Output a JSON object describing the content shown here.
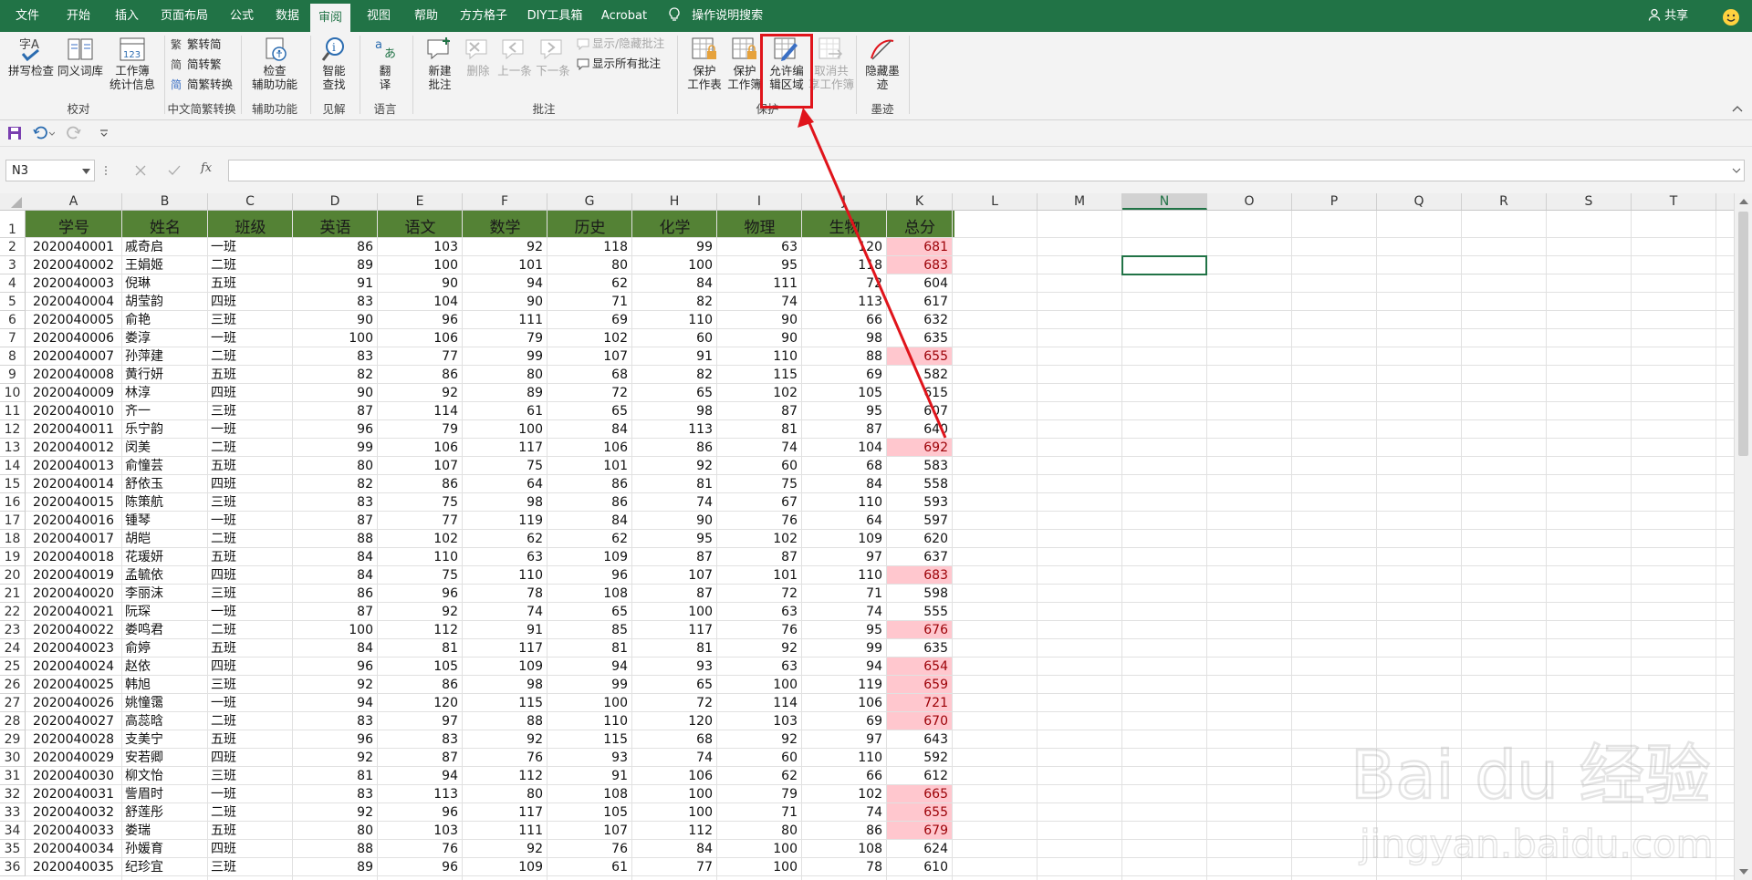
{
  "tabs": [
    {
      "label": "文件"
    },
    {
      "label": "开始"
    },
    {
      "label": "插入"
    },
    {
      "label": "页面布局"
    },
    {
      "label": "公式"
    },
    {
      "label": "数据"
    },
    {
      "label": "审阅"
    },
    {
      "label": "视图"
    },
    {
      "label": "帮助"
    },
    {
      "label": "方方格子"
    },
    {
      "label": "DIY工具箱"
    },
    {
      "label": "Acrobat"
    }
  ],
  "active_tab": "审阅",
  "search_label": "操作说明搜索",
  "share_label": "共享",
  "ribbon": {
    "spell": "拼写检查",
    "thesaurus": "同义词库",
    "stats_l1": "工作簿",
    "stats_l2": "统计信息",
    "g_proof": "校对",
    "t2s": "繁转简",
    "s2t": "简转繁",
    "conv": "简繁转换",
    "g_chinese": "中文简繁转换",
    "access_l1": "检查",
    "access_l2": "辅助功能",
    "g_access": "辅助功能",
    "smart_l1": "智能",
    "smart_l2": "查找",
    "g_insights": "见解",
    "translate_l1": "翻",
    "translate_l2": "译",
    "g_lang": "语言",
    "newc_l1": "新建",
    "newc_l2": "批注",
    "del": "删除",
    "prev": "上一条",
    "next": "下一条",
    "showhide": "显示/隐藏批注",
    "showall": "显示所有批注",
    "g_comments": "批注",
    "psheet_l1": "保护",
    "psheet_l2": "工作表",
    "pbook_l1": "保护",
    "pbook_l2": "工作簿",
    "allow_l1": "允许编",
    "allow_l2": "辑区域",
    "unshare_l1": "取消共",
    "unshare_l2": "享工作簿",
    "g_protect": "保护",
    "ink_l1": "隐藏墨",
    "ink_l2": "迹",
    "g_ink": "墨迹"
  },
  "name_box": "N3",
  "fx": "fx",
  "columns": [
    "A",
    "B",
    "C",
    "D",
    "E",
    "F",
    "G",
    "H",
    "I",
    "J",
    "K",
    "L",
    "M",
    "N",
    "O",
    "P",
    "Q",
    "R",
    "S",
    "T"
  ],
  "header_row": [
    "学号",
    "姓名",
    "班级",
    "英语",
    "语文",
    "数学",
    "历史",
    "化学",
    "物理",
    "生物",
    "总分"
  ],
  "rows": [
    [
      "2020040001",
      "戚奇启",
      "一班",
      "86",
      "103",
      "92",
      "118",
      "99",
      "63",
      "120",
      "681"
    ],
    [
      "2020040002",
      "王娟姬",
      "二班",
      "89",
      "100",
      "101",
      "80",
      "100",
      "95",
      "118",
      "683"
    ],
    [
      "2020040003",
      "倪琳",
      "五班",
      "91",
      "90",
      "94",
      "62",
      "84",
      "111",
      "72",
      "604"
    ],
    [
      "2020040004",
      "胡莹韵",
      "四班",
      "83",
      "104",
      "90",
      "71",
      "82",
      "74",
      "113",
      "617"
    ],
    [
      "2020040005",
      "俞艳",
      "三班",
      "90",
      "96",
      "111",
      "69",
      "110",
      "90",
      "66",
      "632"
    ],
    [
      "2020040006",
      "娄淳",
      "一班",
      "100",
      "106",
      "79",
      "102",
      "60",
      "90",
      "98",
      "635"
    ],
    [
      "2020040007",
      "孙萍建",
      "二班",
      "83",
      "77",
      "99",
      "107",
      "91",
      "110",
      "88",
      "655"
    ],
    [
      "2020040008",
      "黄行妍",
      "五班",
      "82",
      "86",
      "80",
      "68",
      "82",
      "115",
      "69",
      "582"
    ],
    [
      "2020040009",
      "林淳",
      "四班",
      "90",
      "92",
      "89",
      "72",
      "65",
      "102",
      "105",
      "615"
    ],
    [
      "2020040010",
      "齐一",
      "三班",
      "87",
      "114",
      "61",
      "65",
      "98",
      "87",
      "95",
      "607"
    ],
    [
      "2020040011",
      "乐宁韵",
      "一班",
      "96",
      "79",
      "100",
      "84",
      "113",
      "81",
      "87",
      "640"
    ],
    [
      "2020040012",
      "闵美",
      "二班",
      "99",
      "106",
      "117",
      "106",
      "86",
      "74",
      "104",
      "692"
    ],
    [
      "2020040013",
      "俞憧芸",
      "五班",
      "80",
      "107",
      "75",
      "101",
      "92",
      "60",
      "68",
      "583"
    ],
    [
      "2020040014",
      "舒依玉",
      "四班",
      "82",
      "86",
      "64",
      "86",
      "81",
      "75",
      "84",
      "558"
    ],
    [
      "2020040015",
      "陈策航",
      "三班",
      "83",
      "75",
      "98",
      "86",
      "74",
      "67",
      "110",
      "593"
    ],
    [
      "2020040016",
      "锺琴",
      "一班",
      "87",
      "77",
      "119",
      "84",
      "90",
      "76",
      "64",
      "597"
    ],
    [
      "2020040017",
      "胡皑",
      "二班",
      "88",
      "102",
      "62",
      "62",
      "95",
      "102",
      "109",
      "620"
    ],
    [
      "2020040018",
      "花瑗妍",
      "五班",
      "84",
      "110",
      "63",
      "109",
      "87",
      "87",
      "97",
      "637"
    ],
    [
      "2020040019",
      "孟毓依",
      "四班",
      "84",
      "75",
      "110",
      "96",
      "107",
      "101",
      "110",
      "683"
    ],
    [
      "2020040020",
      "李丽沫",
      "三班",
      "86",
      "96",
      "78",
      "108",
      "87",
      "72",
      "71",
      "598"
    ],
    [
      "2020040021",
      "阮琛",
      "一班",
      "87",
      "92",
      "74",
      "65",
      "100",
      "63",
      "74",
      "555"
    ],
    [
      "2020040022",
      "娄鸣君",
      "二班",
      "100",
      "112",
      "91",
      "85",
      "117",
      "76",
      "95",
      "676"
    ],
    [
      "2020040023",
      "俞婷",
      "五班",
      "84",
      "81",
      "117",
      "81",
      "81",
      "92",
      "99",
      "635"
    ],
    [
      "2020040024",
      "赵依",
      "四班",
      "96",
      "105",
      "109",
      "94",
      "93",
      "63",
      "94",
      "654"
    ],
    [
      "2020040025",
      "韩旭",
      "三班",
      "92",
      "86",
      "98",
      "99",
      "65",
      "100",
      "119",
      "659"
    ],
    [
      "2020040026",
      "姚憧霭",
      "一班",
      "94",
      "120",
      "115",
      "100",
      "72",
      "114",
      "106",
      "721"
    ],
    [
      "2020040027",
      "高蕊晗",
      "二班",
      "83",
      "97",
      "88",
      "110",
      "120",
      "103",
      "69",
      "670"
    ],
    [
      "2020040028",
      "支美宁",
      "五班",
      "96",
      "83",
      "92",
      "115",
      "68",
      "92",
      "97",
      "643"
    ],
    [
      "2020040029",
      "安若卿",
      "四班",
      "92",
      "87",
      "76",
      "93",
      "74",
      "60",
      "110",
      "592"
    ],
    [
      "2020040030",
      "柳文怡",
      "三班",
      "81",
      "94",
      "112",
      "91",
      "106",
      "62",
      "66",
      "612"
    ],
    [
      "2020040031",
      "訾眉时",
      "一班",
      "83",
      "113",
      "80",
      "108",
      "100",
      "79",
      "102",
      "665"
    ],
    [
      "2020040032",
      "舒莲彤",
      "二班",
      "92",
      "96",
      "117",
      "105",
      "100",
      "71",
      "74",
      "655"
    ],
    [
      "2020040033",
      "娄瑞",
      "五班",
      "80",
      "103",
      "111",
      "107",
      "112",
      "80",
      "86",
      "679"
    ],
    [
      "2020040034",
      "孙媛育",
      "四班",
      "88",
      "76",
      "92",
      "76",
      "84",
      "100",
      "108",
      "624"
    ],
    [
      "2020040035",
      "纪珍宜",
      "三班",
      "89",
      "96",
      "109",
      "61",
      "77",
      "100",
      "78",
      "610"
    ]
  ],
  "highlight_threshold": 650,
  "colors": {
    "ribbon_green": "#217346",
    "header_fill": "#548235",
    "hl_fill": "#ffc7ce",
    "hl_text": "#9c0006",
    "annotation_red": "#e0141b"
  },
  "watermark_l1": "Bai du 经验",
  "watermark_l2": "jingyan.baidu.com"
}
